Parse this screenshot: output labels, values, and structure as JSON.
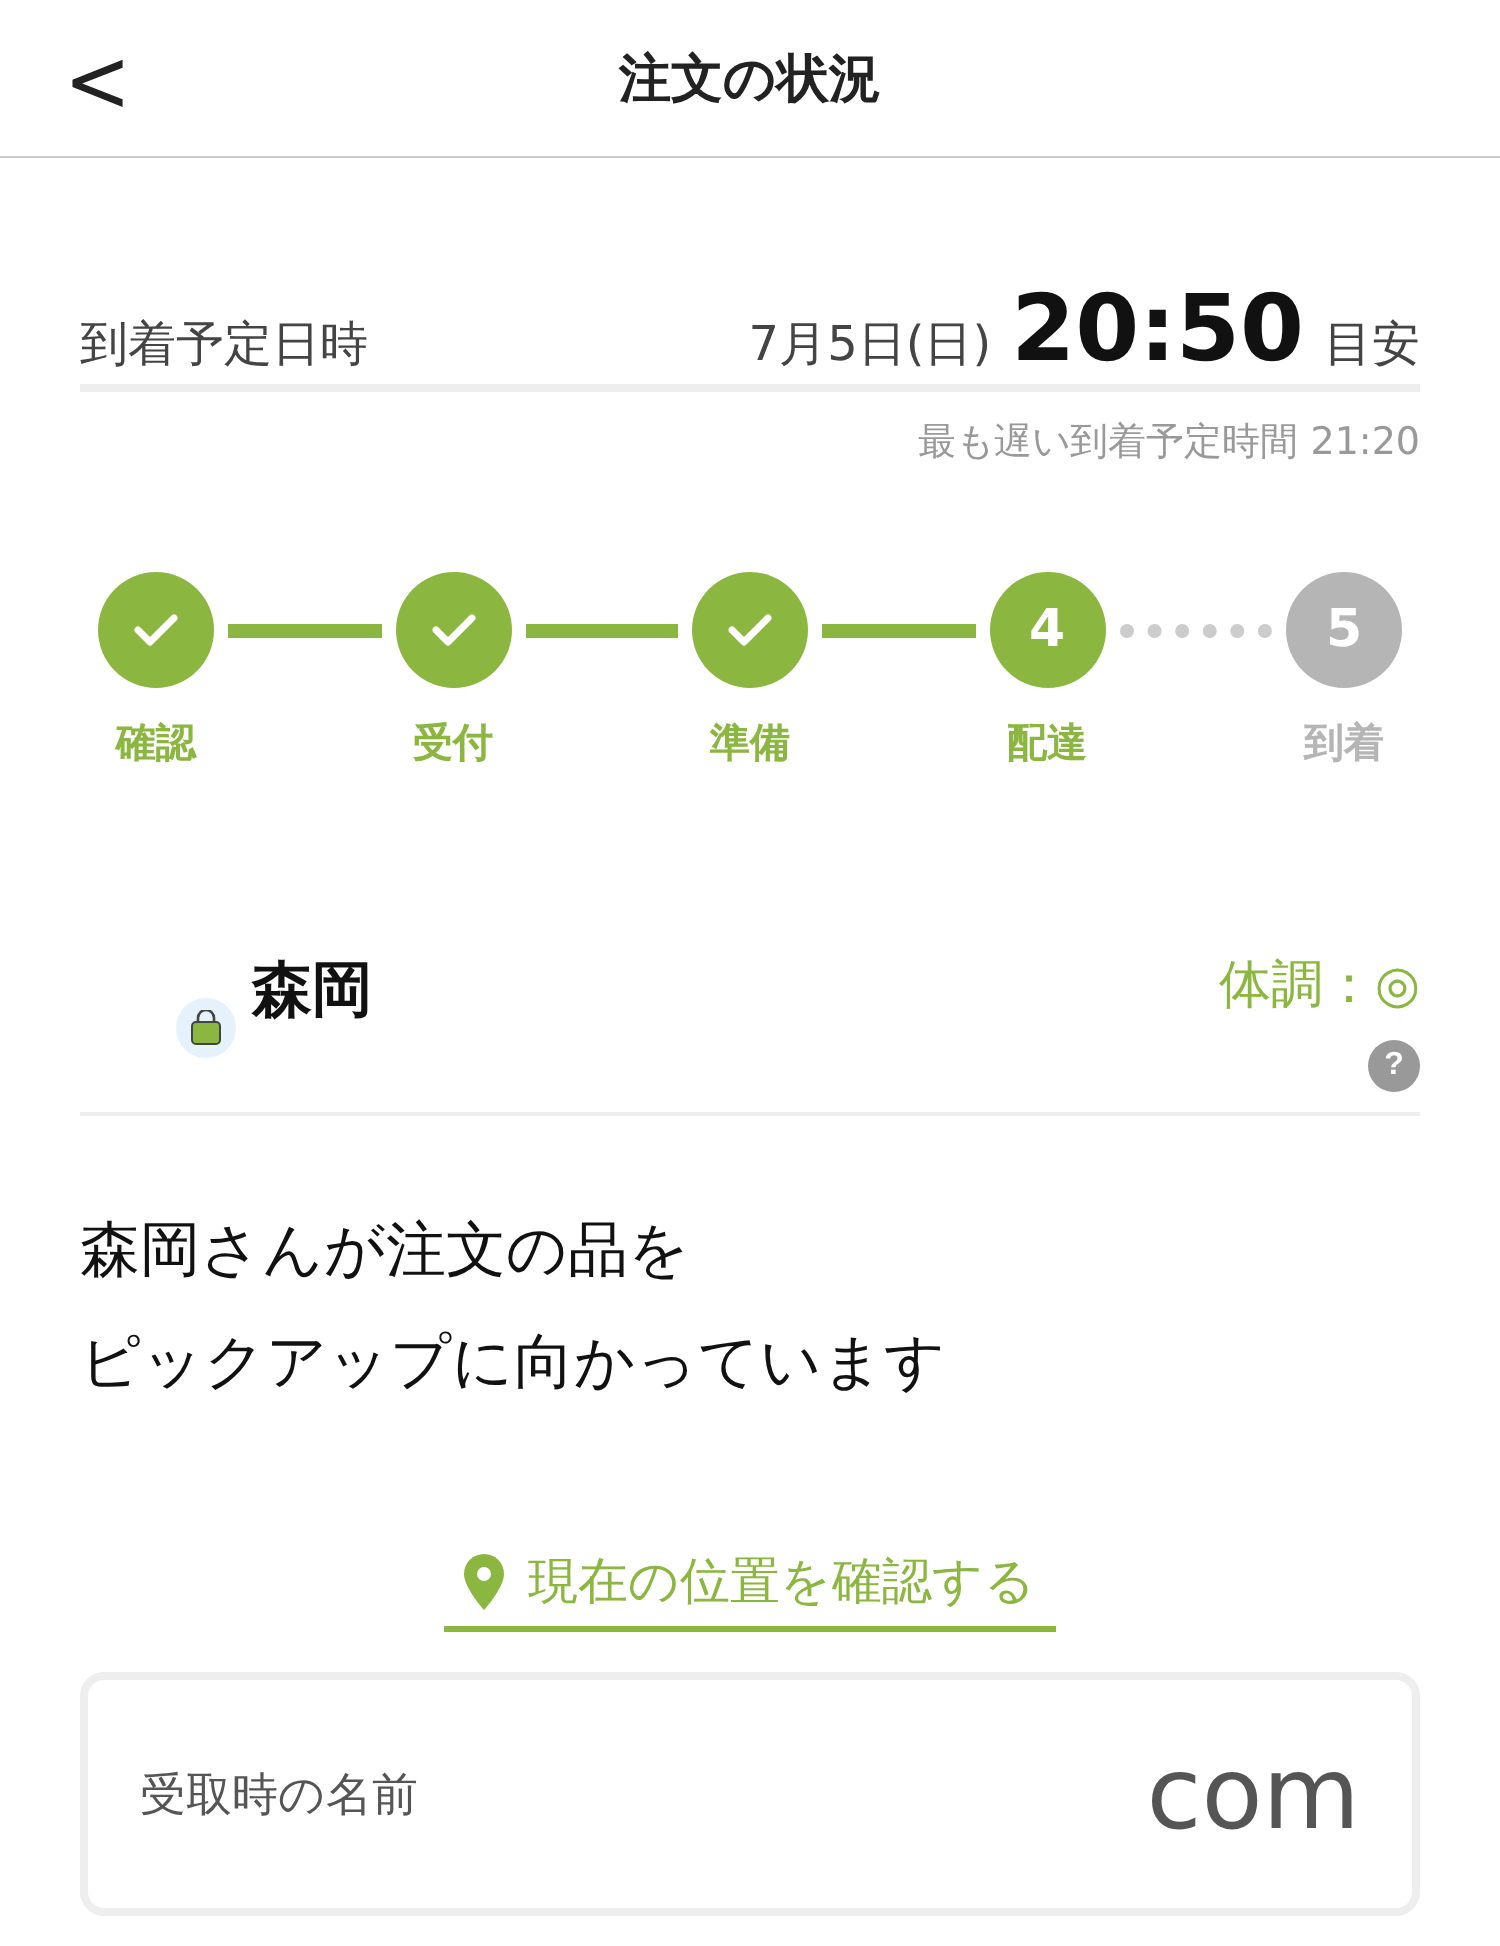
{
  "header": {
    "back": "<",
    "title": "注文の状況"
  },
  "arrival": {
    "label": "到着予定日時",
    "date": "7月5日(日)",
    "time": "20:50",
    "suffix": "目安",
    "latest": "最も遅い到着予定時間 21:20"
  },
  "steps": [
    {
      "label": "確認",
      "done": true,
      "active": true
    },
    {
      "label": "受付",
      "done": true,
      "active": true
    },
    {
      "label": "準備",
      "done": true,
      "active": true
    },
    {
      "label": "配達",
      "done": false,
      "active": true,
      "number": "4"
    },
    {
      "label": "到着",
      "done": false,
      "active": false,
      "number": "5"
    }
  ],
  "courier": {
    "name": "森岡",
    "condition": "体調：◎",
    "help": "?"
  },
  "message": [
    "森岡さんが注文の品を",
    "ピックアップに向かっています"
  ],
  "location_link": "現在の位置を確認する",
  "pickup_name": {
    "label": "受取時の名前",
    "value": "com"
  }
}
